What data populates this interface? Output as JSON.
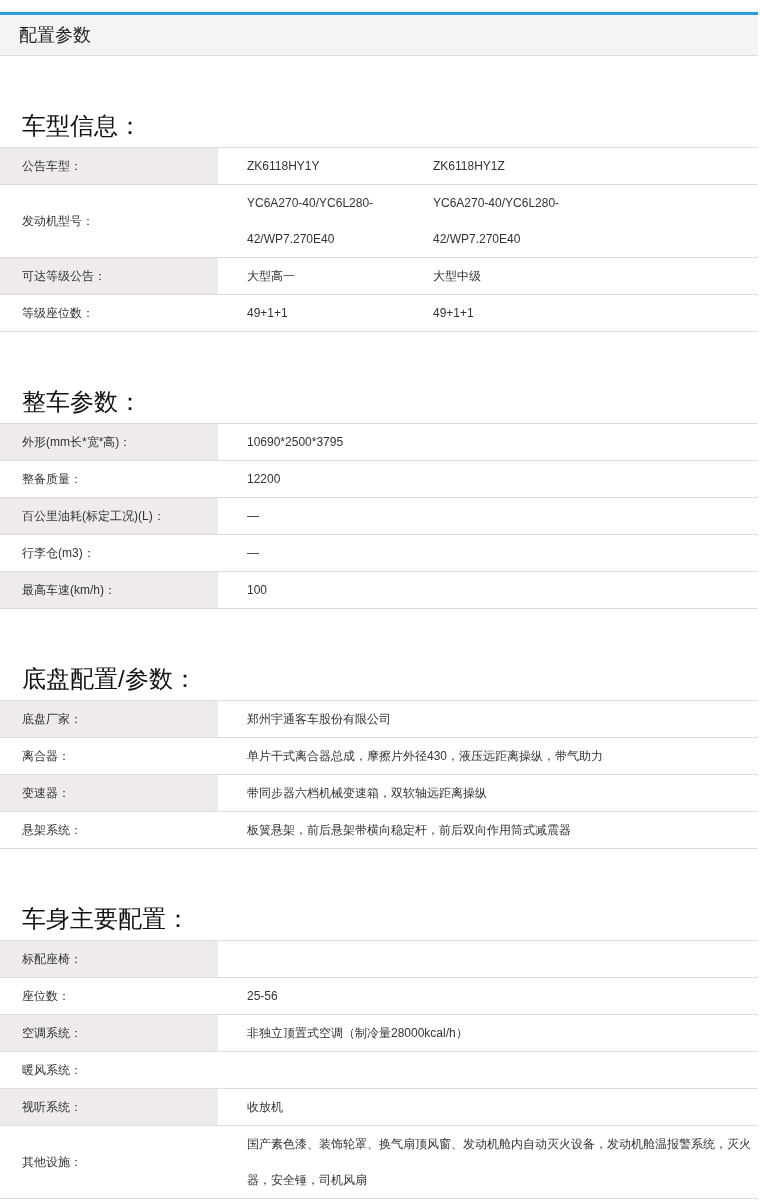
{
  "header": {
    "title": "配置参数"
  },
  "sections": [
    {
      "title": "车型信息：",
      "rows": [
        {
          "label": "公告车型：",
          "values": [
            "ZK6118HY1Y",
            "ZK6118HY1Z"
          ]
        },
        {
          "label": "发动机型号：",
          "values": [
            "YC6A270-40/YC6L280-42/WP7.270E40",
            "YC6A270-40/YC6L280-42/WP7.270E40"
          ]
        },
        {
          "label": "可达等级公告：",
          "values": [
            "大型高一",
            "大型中级"
          ]
        },
        {
          "label": "等级座位数：",
          "values": [
            "49+1+1",
            "49+1+1"
          ]
        }
      ]
    },
    {
      "title": "整车参数：",
      "rows": [
        {
          "label": "外形(mm长*宽*高)：",
          "values": [
            "10690*2500*3795"
          ]
        },
        {
          "label": "整备质量：",
          "values": [
            "12200"
          ]
        },
        {
          "label": "百公里油耗(标定工况)(L)：",
          "values": [
            "—"
          ]
        },
        {
          "label": "行李仓(m3)：",
          "values": [
            "—"
          ]
        },
        {
          "label": "最高车速(km/h)：",
          "values": [
            "100"
          ]
        }
      ]
    },
    {
      "title": "底盘配置/参数：",
      "rows": [
        {
          "label": "底盘厂家：",
          "values": [
            "郑州宇通客车股份有限公司"
          ]
        },
        {
          "label": "离合器：",
          "values": [
            "单片干式离合器总成，摩擦片外径430，液压远距离操纵，带气助力"
          ]
        },
        {
          "label": "变速器：",
          "values": [
            "带同步器六档机械变速箱，双软轴远距离操纵"
          ]
        },
        {
          "label": "悬架系统：",
          "values": [
            "板簧悬架，前后悬架带横向稳定杆，前后双向作用筒式减震器"
          ]
        }
      ]
    },
    {
      "title": "车身主要配置：",
      "rows": [
        {
          "label": "标配座椅："
        },
        {
          "label": "座位数：",
          "values": [
            "25-56"
          ]
        },
        {
          "label": "空调系统：",
          "values": [
            "非独立顶置式空调（制冷量28000kcal/h）"
          ]
        },
        {
          "label": "暖风系统："
        },
        {
          "label": "视听系统：",
          "values": [
            "收放机"
          ]
        },
        {
          "label": "其他设施：",
          "values": [
            "国产素色漆、装饰轮罩、换气扇顶风窗、发动机舱内自动灭火设备，发动机舱温报警系统，灭火器，安全锤，司机风扇"
          ]
        }
      ]
    }
  ]
}
